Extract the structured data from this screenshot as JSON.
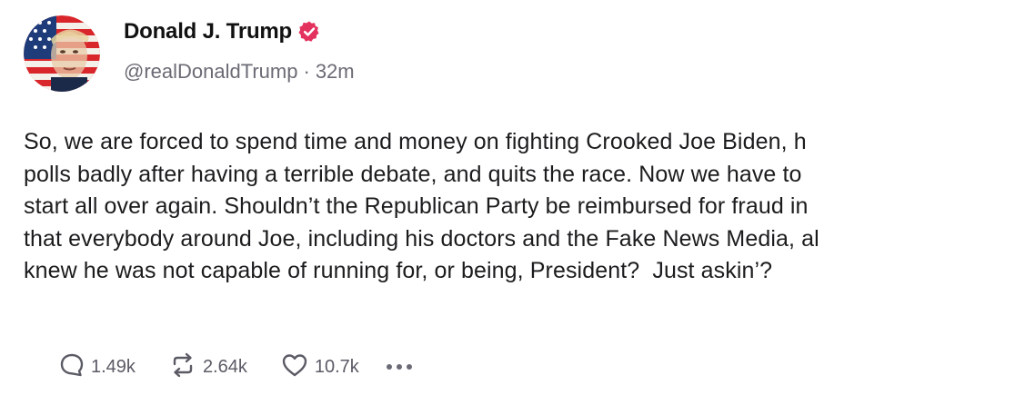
{
  "author": {
    "display_name": "Donald J. Trump",
    "handle": "@realDonaldTrump",
    "separator": "·",
    "timestamp": "32m",
    "verified_icon": "verified-badge-icon",
    "verified_color": "#e4325f"
  },
  "post": {
    "lines": [
      "So, we are forced to spend time and money on fighting Crooked Joe Biden, h",
      "polls badly after having a terrible debate, and quits the race. Now we have to",
      "start all over again. Shouldn’t the Republican Party be reimbursed for fraud in",
      "that everybody around Joe, including his doctors and the Fake News Media, al",
      "knew he was not capable of running for, or being, President?  Just askin’?"
    ]
  },
  "actions": {
    "replies": {
      "icon": "reply-icon",
      "count": "1.49k"
    },
    "retruths": {
      "icon": "retruth-icon",
      "count": "2.64k"
    },
    "likes": {
      "icon": "heart-icon",
      "count": "10.7k"
    },
    "more": {
      "icon": "more-options-icon"
    }
  },
  "colors": {
    "text": "#1c1c1e",
    "muted": "#6b6b75"
  }
}
